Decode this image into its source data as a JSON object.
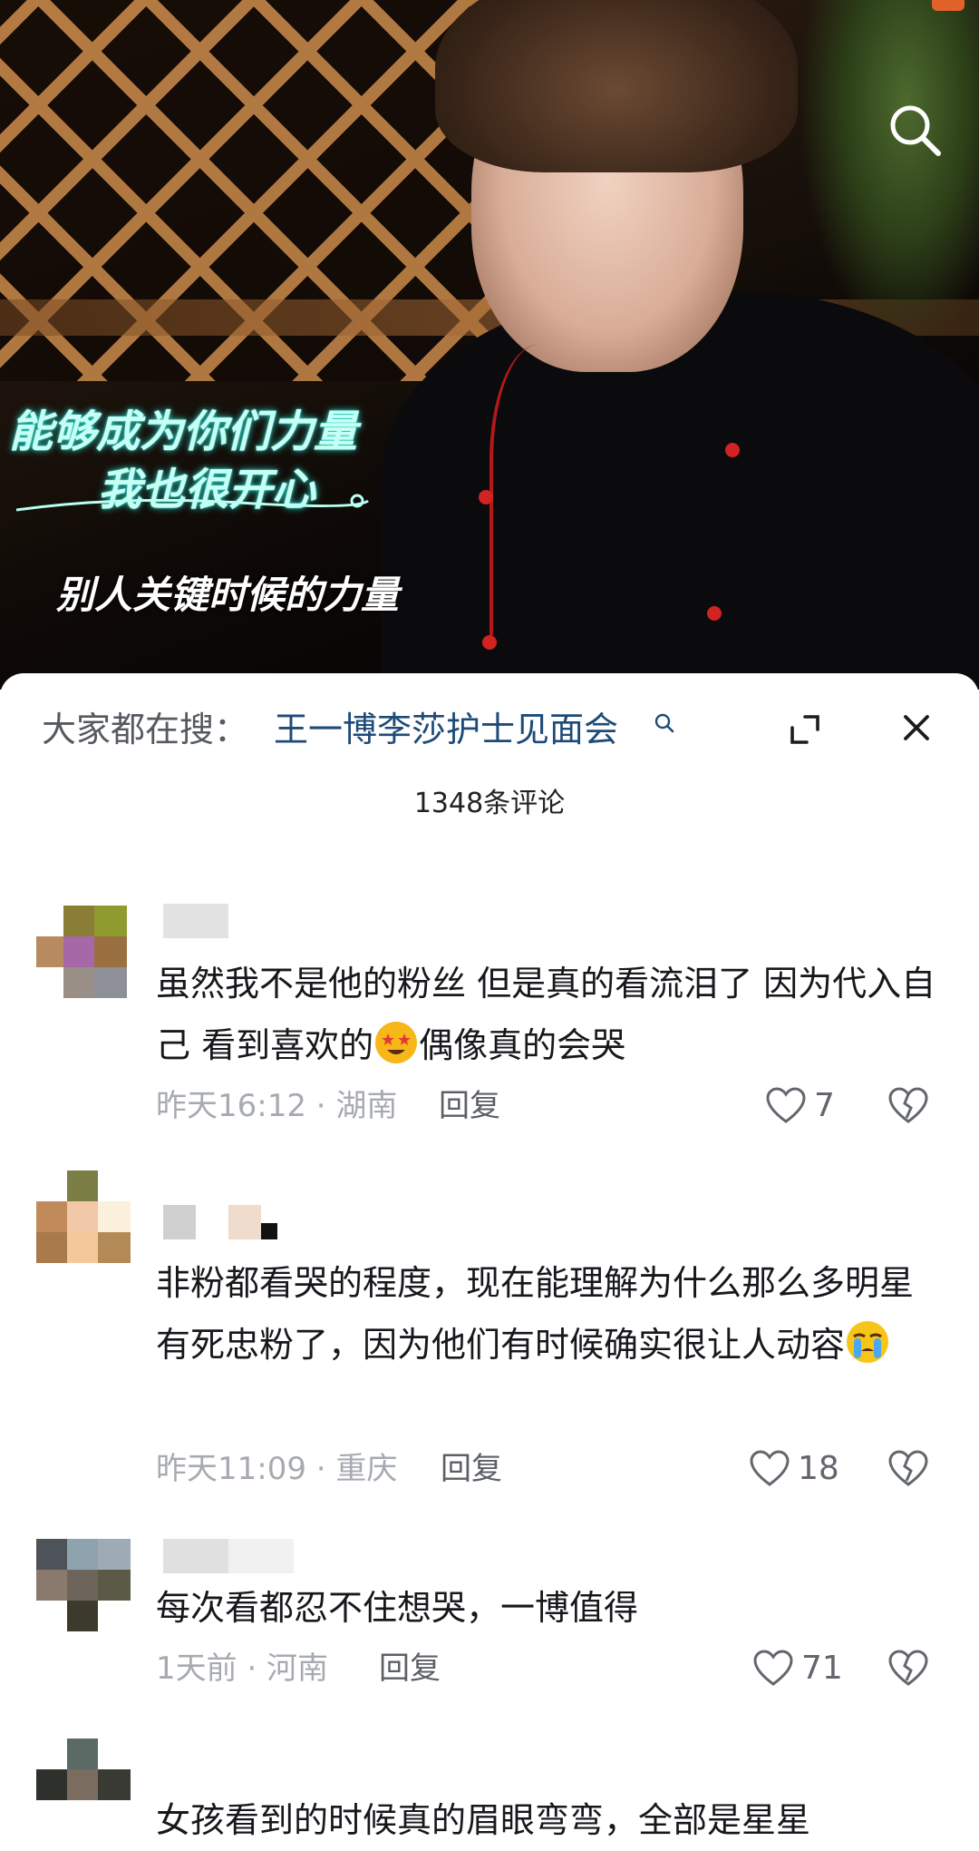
{
  "video": {
    "caption_line1": "能够成为你们力量",
    "caption_line2": "我也很开心",
    "caption_bottom": "别人关键时候的力量",
    "icon": "search-icon"
  },
  "sheet": {
    "suggest_prefix": "大家都在搜：",
    "suggest_query": "王一博李莎护士见面会",
    "comment_count": "1348条评论",
    "icons": [
      "expand-icon",
      "close-icon"
    ]
  },
  "comments": [
    {
      "text_a": "虽然我不是他的粉丝 但是真的看流泪了 因为代入自己 看到喜欢的",
      "emoji": "star-struck-emoji",
      "text_b": "偶像真的会哭",
      "time": "昨天16:12 · 湖南",
      "reply": "回复",
      "likes": "7"
    },
    {
      "text_a": "非粉都看哭的程度，现在能理解为什么那么多明星有死忠粉了，因为他们有时候确实很让人动容",
      "emoji": "crying-emoji",
      "text_b": "",
      "time": "昨天11:09 · 重庆",
      "reply": "回复",
      "likes": "18"
    },
    {
      "text_a": "每次看都忍不住想哭，一博值得",
      "emoji": "",
      "text_b": "",
      "time": "1天前 · 河南",
      "reply": "回复",
      "likes": "71"
    },
    {
      "text_a": "女孩看到的时候真的眉眼弯弯，全部是星星",
      "emoji": "",
      "text_b": "",
      "time": "",
      "reply": "",
      "likes": ""
    }
  ]
}
